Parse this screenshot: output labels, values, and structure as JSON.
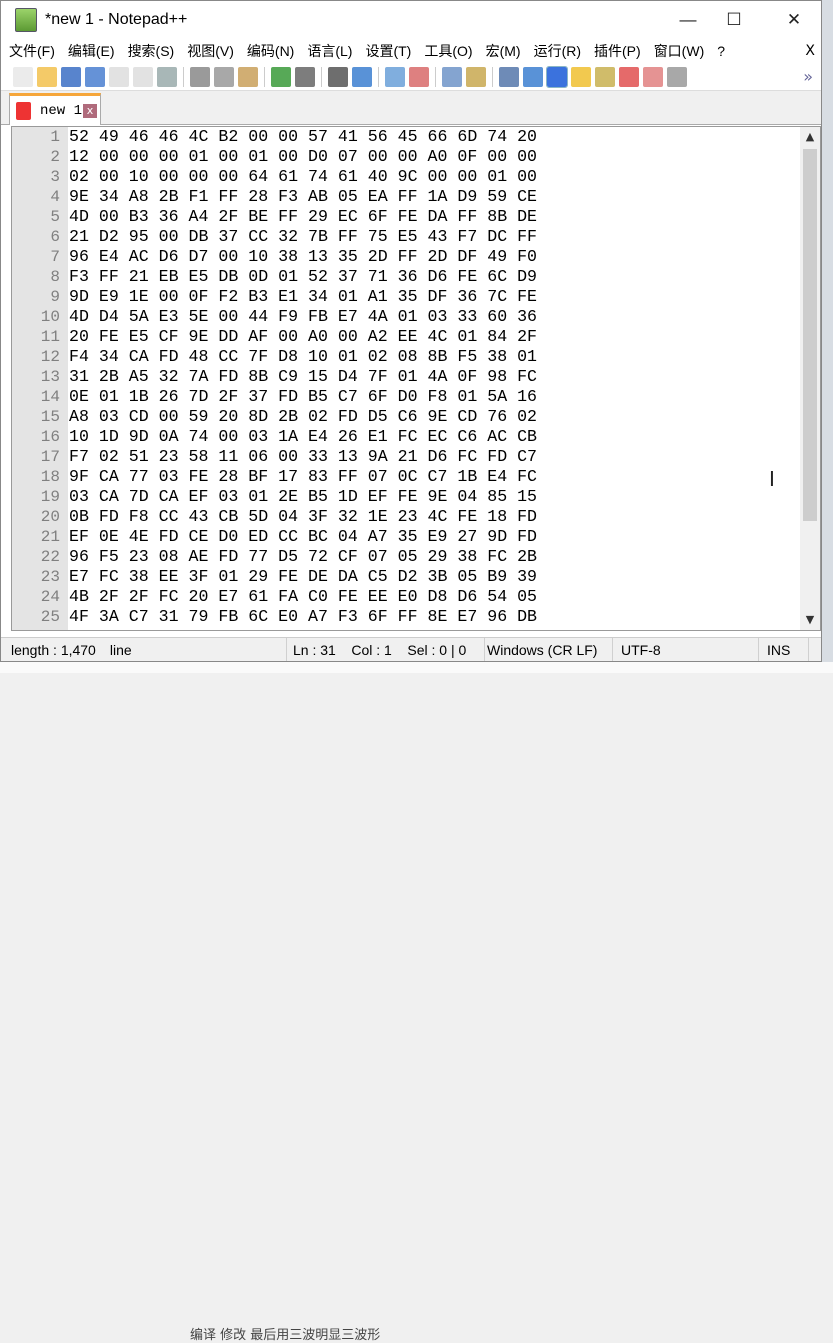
{
  "window": {
    "title": "*new 1 - Notepad++",
    "minimize": "—",
    "maximize": "☐",
    "close": "✕"
  },
  "menu": [
    "文件(F)",
    "编辑(E)",
    "搜索(S)",
    "视图(V)",
    "编码(N)",
    "语言(L)",
    "设置(T)",
    "工具(O)",
    "宏(M)",
    "运行(R)",
    "插件(P)",
    "窗口(W)",
    "?"
  ],
  "menu_close": "X",
  "toolbar": [
    "new",
    "open",
    "save",
    "save-all",
    "close",
    "close-all",
    "print",
    "cut",
    "copy",
    "paste",
    "undo",
    "redo",
    "find",
    "replace",
    "zoom-in",
    "zoom-out",
    "sync-vertical",
    "sync-horizontal",
    "word-wrap",
    "show-all-chars",
    "indent-guide",
    "doc-map",
    "function-list",
    "folder-workspace",
    "monitoring",
    "macro-record"
  ],
  "toolbar_more": "»",
  "tab": {
    "label": "new 1",
    "close": "x"
  },
  "editor": {
    "lines": [
      "52 49 46 46 4C B2 00 00 57 41 56 45 66 6D 74 20",
      "12 00 00 00 01 00 01 00 D0 07 00 00 A0 0F 00 00",
      "02 00 10 00 00 00 64 61 74 61 40 9C 00 00 01 00",
      "9E 34 A8 2B F1 FF 28 F3 AB 05 EA FF 1A D9 59 CE",
      "4D 00 B3 36 A4 2F BE FF 29 EC 6F FE DA FF 8B DE",
      "21 D2 95 00 DB 37 CC 32 7B FF 75 E5 43 F7 DC FF",
      "96 E4 AC D6 D7 00 10 38 13 35 2D FF 2D DF 49 F0",
      "F3 FF 21 EB E5 DB 0D 01 52 37 71 36 D6 FE 6C D9",
      "9D E9 1E 00 0F F2 B3 E1 34 01 A1 35 DF 36 7C FE",
      "4D D4 5A E3 5E 00 44 F9 FB E7 4A 01 03 33 60 36",
      "20 FE E5 CF 9E DD AF 00 A0 00 A2 EE 4C 01 84 2F",
      "F4 34 CA FD 48 CC 7F D8 10 01 02 08 8B F5 38 01",
      "31 2B A5 32 7A FD 8B C9 15 D4 7F 01 4A 0F 98 FC",
      "0E 01 1B 26 7D 2F 37 FD B5 C7 6F D0 F8 01 5A 16",
      "A8 03 CD 00 59 20 8D 2B 02 FD D5 C6 9E CD 76 02",
      "10 1D 9D 0A 74 00 03 1A E4 26 E1 FC EC C6 AC CB",
      "F7 02 51 23 58 11 06 00 33 13 9A 21 D6 FC FD C7",
      "9F CA 77 03 FE 28 BF 17 83 FF 07 0C C7 1B E4 FC",
      "03 CA 7D CA EF 03 01 2E B5 1D EF FE 9E 04 85 15",
      "0B FD F8 CC 43 CB 5D 04 3F 32 1E 23 4C FE 18 FD",
      "EF 0E 4E FD CE D0 ED CC BC 04 A7 35 E9 27 9D FD",
      "96 F5 23 08 AE FD 77 D5 72 CF 07 05 29 38 FC 2B",
      "E7 FC 38 EE 3F 01 29 FE DE DA C5 D2 3B 05 B9 39",
      "4B 2F 2F FC 20 E7 61 FA C0 FE EE E0 D8 D6 54 05",
      "4F 3A C7 31 79 FB 6C E0 A7 F3 6F FF 8E E7 96 DB"
    ],
    "line_numbers": [
      "1",
      "2",
      "3",
      "4",
      "5",
      "6",
      "7",
      "8",
      "9",
      "10",
      "11",
      "12",
      "13",
      "14",
      "15",
      "16",
      "17",
      "18",
      "19",
      "20",
      "21",
      "22",
      "23",
      "24",
      "25"
    ]
  },
  "status": {
    "length": "length : 1,470",
    "line": "line",
    "pos": "Ln : 31    Col : 1    Sel : 0 | 0",
    "eol": "Windows (CR LF)",
    "encoding": "UTF-8",
    "mode": "INS"
  },
  "background_text": "编译  修改  最后用三波明显三波形"
}
